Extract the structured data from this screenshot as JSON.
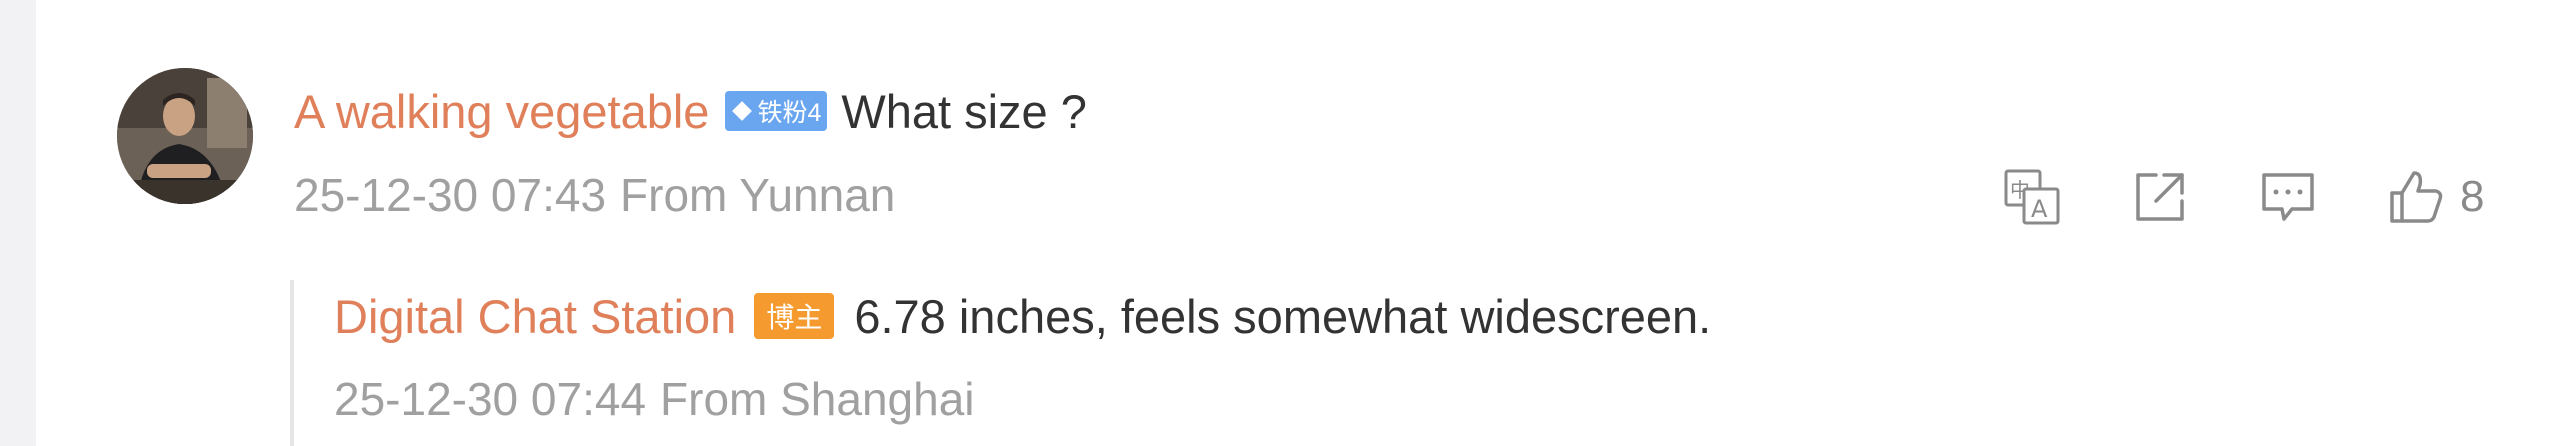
{
  "comment": {
    "username": "A walking vegetable",
    "fan_badge": "铁粉4",
    "text": "What size ?",
    "date": "25-12-30 07:43",
    "location": "From Yunnan",
    "like_count": "8",
    "actions": [
      "translate-icon",
      "share-icon",
      "comment-icon",
      "like-icon"
    ]
  },
  "reply": {
    "username": "Digital Chat Station",
    "host_badge": "博主",
    "text": "6.78 inches, feels somewhat widescreen.",
    "date": "25-12-30 07:44",
    "location": "From Shanghai"
  },
  "colors": {
    "username": "#e0805b",
    "fan_badge": "#6aa6f0",
    "host_badge": "#f59a2e",
    "meta": "#a0a0a0"
  }
}
